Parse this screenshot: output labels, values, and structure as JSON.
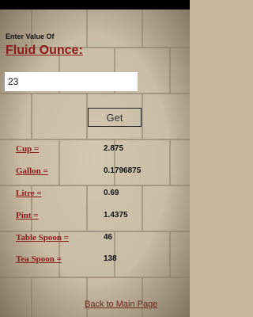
{
  "header": {
    "heading": "Enter Value Of",
    "title": "Fluid Ounce:"
  },
  "input": {
    "value": "23"
  },
  "get_button": {
    "label": "Get"
  },
  "results": [
    {
      "label": "Cup =",
      "value": "2.875"
    },
    {
      "label": "Gallon =",
      "value": "0.1796875"
    },
    {
      "label": "Litre =",
      "value": "0.69"
    },
    {
      "label": "Pint =",
      "value": "1.4375"
    },
    {
      "label": "Table Spoon =",
      "value": "46"
    },
    {
      "label": "Tea Spoon =",
      "value": "138"
    }
  ],
  "footer": {
    "back_link": "Back to Main Page"
  },
  "colors": {
    "label_red": "#8b1a1a",
    "wall": "#c9bba4",
    "mortar": "#8a7a66"
  }
}
